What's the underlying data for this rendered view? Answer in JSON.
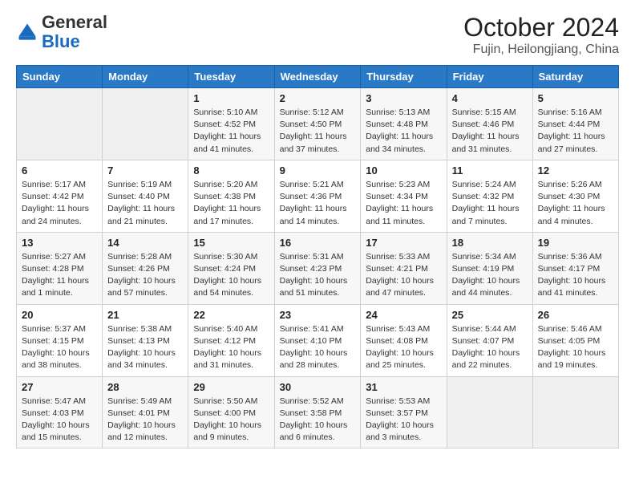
{
  "header": {
    "logo_general": "General",
    "logo_blue": "Blue",
    "month_year": "October 2024",
    "location": "Fujin, Heilongjiang, China"
  },
  "weekdays": [
    "Sunday",
    "Monday",
    "Tuesday",
    "Wednesday",
    "Thursday",
    "Friday",
    "Saturday"
  ],
  "weeks": [
    [
      {
        "day": "",
        "info": ""
      },
      {
        "day": "",
        "info": ""
      },
      {
        "day": "1",
        "info": "Sunrise: 5:10 AM\nSunset: 4:52 PM\nDaylight: 11 hours and 41 minutes."
      },
      {
        "day": "2",
        "info": "Sunrise: 5:12 AM\nSunset: 4:50 PM\nDaylight: 11 hours and 37 minutes."
      },
      {
        "day": "3",
        "info": "Sunrise: 5:13 AM\nSunset: 4:48 PM\nDaylight: 11 hours and 34 minutes."
      },
      {
        "day": "4",
        "info": "Sunrise: 5:15 AM\nSunset: 4:46 PM\nDaylight: 11 hours and 31 minutes."
      },
      {
        "day": "5",
        "info": "Sunrise: 5:16 AM\nSunset: 4:44 PM\nDaylight: 11 hours and 27 minutes."
      }
    ],
    [
      {
        "day": "6",
        "info": "Sunrise: 5:17 AM\nSunset: 4:42 PM\nDaylight: 11 hours and 24 minutes."
      },
      {
        "day": "7",
        "info": "Sunrise: 5:19 AM\nSunset: 4:40 PM\nDaylight: 11 hours and 21 minutes."
      },
      {
        "day": "8",
        "info": "Sunrise: 5:20 AM\nSunset: 4:38 PM\nDaylight: 11 hours and 17 minutes."
      },
      {
        "day": "9",
        "info": "Sunrise: 5:21 AM\nSunset: 4:36 PM\nDaylight: 11 hours and 14 minutes."
      },
      {
        "day": "10",
        "info": "Sunrise: 5:23 AM\nSunset: 4:34 PM\nDaylight: 11 hours and 11 minutes."
      },
      {
        "day": "11",
        "info": "Sunrise: 5:24 AM\nSunset: 4:32 PM\nDaylight: 11 hours and 7 minutes."
      },
      {
        "day": "12",
        "info": "Sunrise: 5:26 AM\nSunset: 4:30 PM\nDaylight: 11 hours and 4 minutes."
      }
    ],
    [
      {
        "day": "13",
        "info": "Sunrise: 5:27 AM\nSunset: 4:28 PM\nDaylight: 11 hours and 1 minute."
      },
      {
        "day": "14",
        "info": "Sunrise: 5:28 AM\nSunset: 4:26 PM\nDaylight: 10 hours and 57 minutes."
      },
      {
        "day": "15",
        "info": "Sunrise: 5:30 AM\nSunset: 4:24 PM\nDaylight: 10 hours and 54 minutes."
      },
      {
        "day": "16",
        "info": "Sunrise: 5:31 AM\nSunset: 4:23 PM\nDaylight: 10 hours and 51 minutes."
      },
      {
        "day": "17",
        "info": "Sunrise: 5:33 AM\nSunset: 4:21 PM\nDaylight: 10 hours and 47 minutes."
      },
      {
        "day": "18",
        "info": "Sunrise: 5:34 AM\nSunset: 4:19 PM\nDaylight: 10 hours and 44 minutes."
      },
      {
        "day": "19",
        "info": "Sunrise: 5:36 AM\nSunset: 4:17 PM\nDaylight: 10 hours and 41 minutes."
      }
    ],
    [
      {
        "day": "20",
        "info": "Sunrise: 5:37 AM\nSunset: 4:15 PM\nDaylight: 10 hours and 38 minutes."
      },
      {
        "day": "21",
        "info": "Sunrise: 5:38 AM\nSunset: 4:13 PM\nDaylight: 10 hours and 34 minutes."
      },
      {
        "day": "22",
        "info": "Sunrise: 5:40 AM\nSunset: 4:12 PM\nDaylight: 10 hours and 31 minutes."
      },
      {
        "day": "23",
        "info": "Sunrise: 5:41 AM\nSunset: 4:10 PM\nDaylight: 10 hours and 28 minutes."
      },
      {
        "day": "24",
        "info": "Sunrise: 5:43 AM\nSunset: 4:08 PM\nDaylight: 10 hours and 25 minutes."
      },
      {
        "day": "25",
        "info": "Sunrise: 5:44 AM\nSunset: 4:07 PM\nDaylight: 10 hours and 22 minutes."
      },
      {
        "day": "26",
        "info": "Sunrise: 5:46 AM\nSunset: 4:05 PM\nDaylight: 10 hours and 19 minutes."
      }
    ],
    [
      {
        "day": "27",
        "info": "Sunrise: 5:47 AM\nSunset: 4:03 PM\nDaylight: 10 hours and 15 minutes."
      },
      {
        "day": "28",
        "info": "Sunrise: 5:49 AM\nSunset: 4:01 PM\nDaylight: 10 hours and 12 minutes."
      },
      {
        "day": "29",
        "info": "Sunrise: 5:50 AM\nSunset: 4:00 PM\nDaylight: 10 hours and 9 minutes."
      },
      {
        "day": "30",
        "info": "Sunrise: 5:52 AM\nSunset: 3:58 PM\nDaylight: 10 hours and 6 minutes."
      },
      {
        "day": "31",
        "info": "Sunrise: 5:53 AM\nSunset: 3:57 PM\nDaylight: 10 hours and 3 minutes."
      },
      {
        "day": "",
        "info": ""
      },
      {
        "day": "",
        "info": ""
      }
    ]
  ],
  "colors": {
    "header_bg": "#2979c7",
    "logo_blue": "#1a6bbf"
  }
}
